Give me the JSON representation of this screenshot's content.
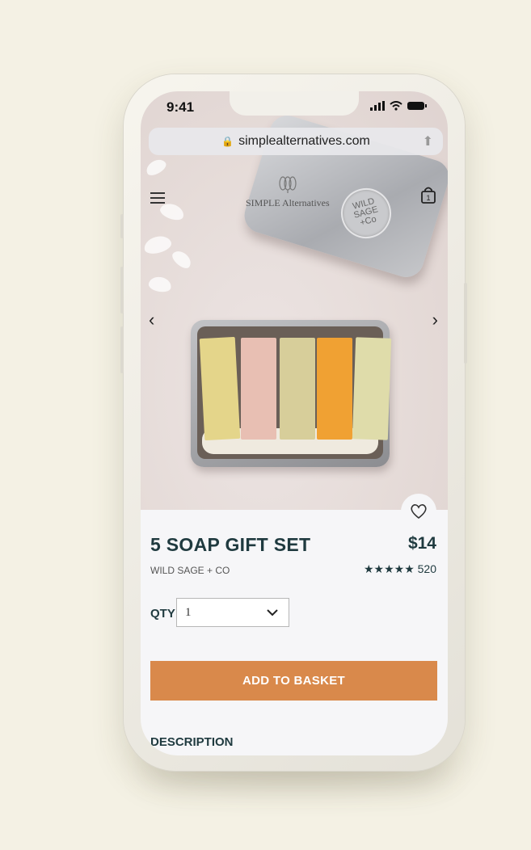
{
  "status_bar": {
    "time": "9:41"
  },
  "browser": {
    "url": "simplealternatives.com"
  },
  "site": {
    "logo_text": "SIMPLE Alternatives"
  },
  "product": {
    "image_seal_text": [
      "WILD",
      "SAGE",
      "+Co"
    ],
    "title": "5 SOAP GIFT SET",
    "price": "$14",
    "brand": "WILD SAGE + CO",
    "rating_stars": "★★★★★",
    "rating_value": 5,
    "review_count": "520",
    "qty_label": "QTY",
    "qty_value": "1",
    "add_to_basket_label": "ADD TO BASKET",
    "description_heading": "DESCRIPTION"
  },
  "colors": {
    "accent": "#d9894b",
    "heading": "#1f3a3f",
    "background": "#f4f1e4"
  },
  "icons": [
    "lock-icon",
    "share-icon",
    "menu-icon",
    "bag-icon",
    "chevron-left-icon",
    "chevron-right-icon",
    "heart-icon",
    "chevron-down-icon",
    "signal-icon",
    "wifi-icon",
    "battery-icon"
  ]
}
